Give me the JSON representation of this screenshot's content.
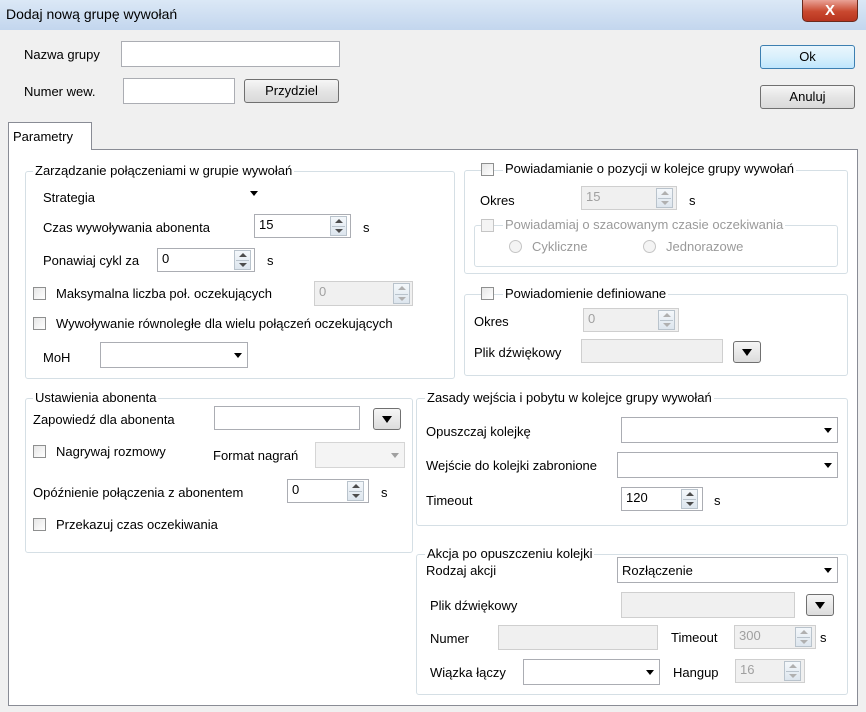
{
  "window": {
    "title": "Dodaj nową grupę wywołań",
    "close_symbol": "X"
  },
  "header": {
    "group_name_label": "Nazwa grupy",
    "group_name_value": "",
    "ext_number_label": "Numer wew.",
    "ext_number_value": "",
    "assign_button": "Przydziel",
    "ok_button": "Ok",
    "cancel_button": "Anuluj"
  },
  "tabs": [
    {
      "label": "Parametry",
      "selected": true
    }
  ],
  "call_management": {
    "legend": "Zarządzanie połączeniami w grupie wywołań",
    "strategy_label": "Strategia",
    "strategy_value": "",
    "ring_time_label": "Czas wywoływania abonenta",
    "ring_time_value": "15",
    "ring_time_unit": "s",
    "retry_label": "Ponawiaj cykl za",
    "retry_value": "0",
    "retry_unit": "s",
    "max_waiting_label": "Maksymalna liczba poł. oczekujących",
    "max_waiting_value": "0",
    "parallel_label": "Wywoływanie równoległe dla wielu połączeń oczekujących",
    "moh_label": "MoH",
    "moh_value": ""
  },
  "position_notify": {
    "legend": "Powiadamianie o pozycji w kolejce grupy wywołań",
    "period_label": "Okres",
    "period_value": "15",
    "period_unit": "s",
    "estimated_label": "Powiadamiaj o szacowanym czasie oczekiwania",
    "cyclic_label": "Cykliczne",
    "oneshot_label": "Jednorazowe"
  },
  "defined_notify": {
    "legend": "Powiadomienie definiowane",
    "period_label": "Okres",
    "period_value": "0",
    "sound_label": "Plik dźwiękowy",
    "sound_value": ""
  },
  "subscriber": {
    "legend": "Ustawienia abonenta",
    "announce_label": "Zapowiedź dla abonenta",
    "announce_value": "",
    "record_label": "Nagrywaj rozmowy",
    "format_label": "Format nagrań",
    "format_value": "",
    "delay_label": "Opóźnienie połączenia z abonentem",
    "delay_value": "0",
    "delay_unit": "s",
    "pass_wait_label": "Przekazuj czas oczekiwania"
  },
  "queue_rules": {
    "legend": "Zasady wejścia i pobytu w kolejce grupy wywołań",
    "leave_label": "Opuszczaj kolejkę",
    "leave_value": "",
    "entry_forbidden_label": "Wejście do kolejki zabronione",
    "entry_forbidden_value": "",
    "timeout_label": "Timeout",
    "timeout_value": "120",
    "timeout_unit": "s"
  },
  "after_leave": {
    "legend": "Akcja po opuszczeniu kolejki",
    "action_type_label": "Rodzaj akcji",
    "action_type_value": "Rozłączenie",
    "sound_label": "Plik dźwiękowy",
    "sound_value": "",
    "number_label": "Numer",
    "number_value": "",
    "timeout_label": "Timeout",
    "timeout_value": "300",
    "timeout_unit": "s",
    "trunk_label": "Wiązka łączy",
    "trunk_value": "",
    "hangup_label": "Hangup",
    "hangup_value": "16"
  }
}
